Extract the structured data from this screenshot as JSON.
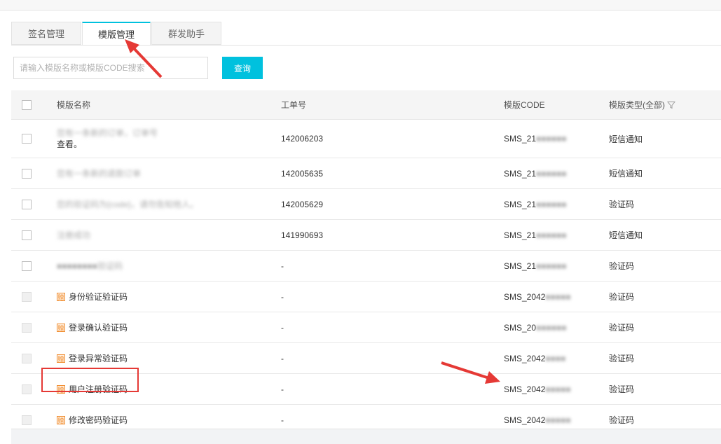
{
  "tabs": [
    "签名管理",
    "模版管理",
    "群发助手"
  ],
  "search": {
    "placeholder": "请输入模版名称或模版CODE搜索",
    "button": "查询"
  },
  "table": {
    "headers": {
      "name": "模版名称",
      "order": "工单号",
      "code": "模版CODE",
      "type": "模版类型(全部)"
    },
    "rows": [
      {
        "name_line1": "您有一条新的订单，订单号",
        "name_line2": "查看。",
        "order": "142006203",
        "code": "SMS_21",
        "type": "短信通知"
      },
      {
        "name": "您有一条新的退款订单",
        "order": "142005635",
        "code": "SMS_21",
        "type": "短信通知"
      },
      {
        "name": "您的验证码为{code}，请勿告知他人。",
        "order": "142005629",
        "code": "SMS_21",
        "type": "验证码"
      },
      {
        "name": "注册成功",
        "order": "141990693",
        "code": "SMS_21",
        "type": "短信通知"
      },
      {
        "name": "验证码",
        "order": "-",
        "code": "SMS_21",
        "type": "验证码"
      },
      {
        "name": "身份验证验证码",
        "gift": "赠",
        "order": "-",
        "code": "SMS_2042",
        "type": "验证码"
      },
      {
        "name": "登录确认验证码",
        "gift": "赠",
        "order": "-",
        "code": "SMS_20",
        "type": "验证码"
      },
      {
        "name": "登录异常验证码",
        "gift": "赠",
        "order": "-",
        "code": "SMS_2042",
        "type": "验证码"
      },
      {
        "name": "用户注册验证码",
        "gift": "赠",
        "order": "-",
        "code": "SMS_2042",
        "type": "验证码"
      },
      {
        "name": "修改密码验证码",
        "gift": "赠",
        "order": "-",
        "code": "SMS_2042",
        "type": "验证码"
      }
    ]
  },
  "colors": {
    "accent": "#00c1de",
    "annotation": "#e53935",
    "gift": "#f08c2e"
  },
  "icons": {
    "filter": "filter-icon",
    "gift": "gift-icon"
  }
}
